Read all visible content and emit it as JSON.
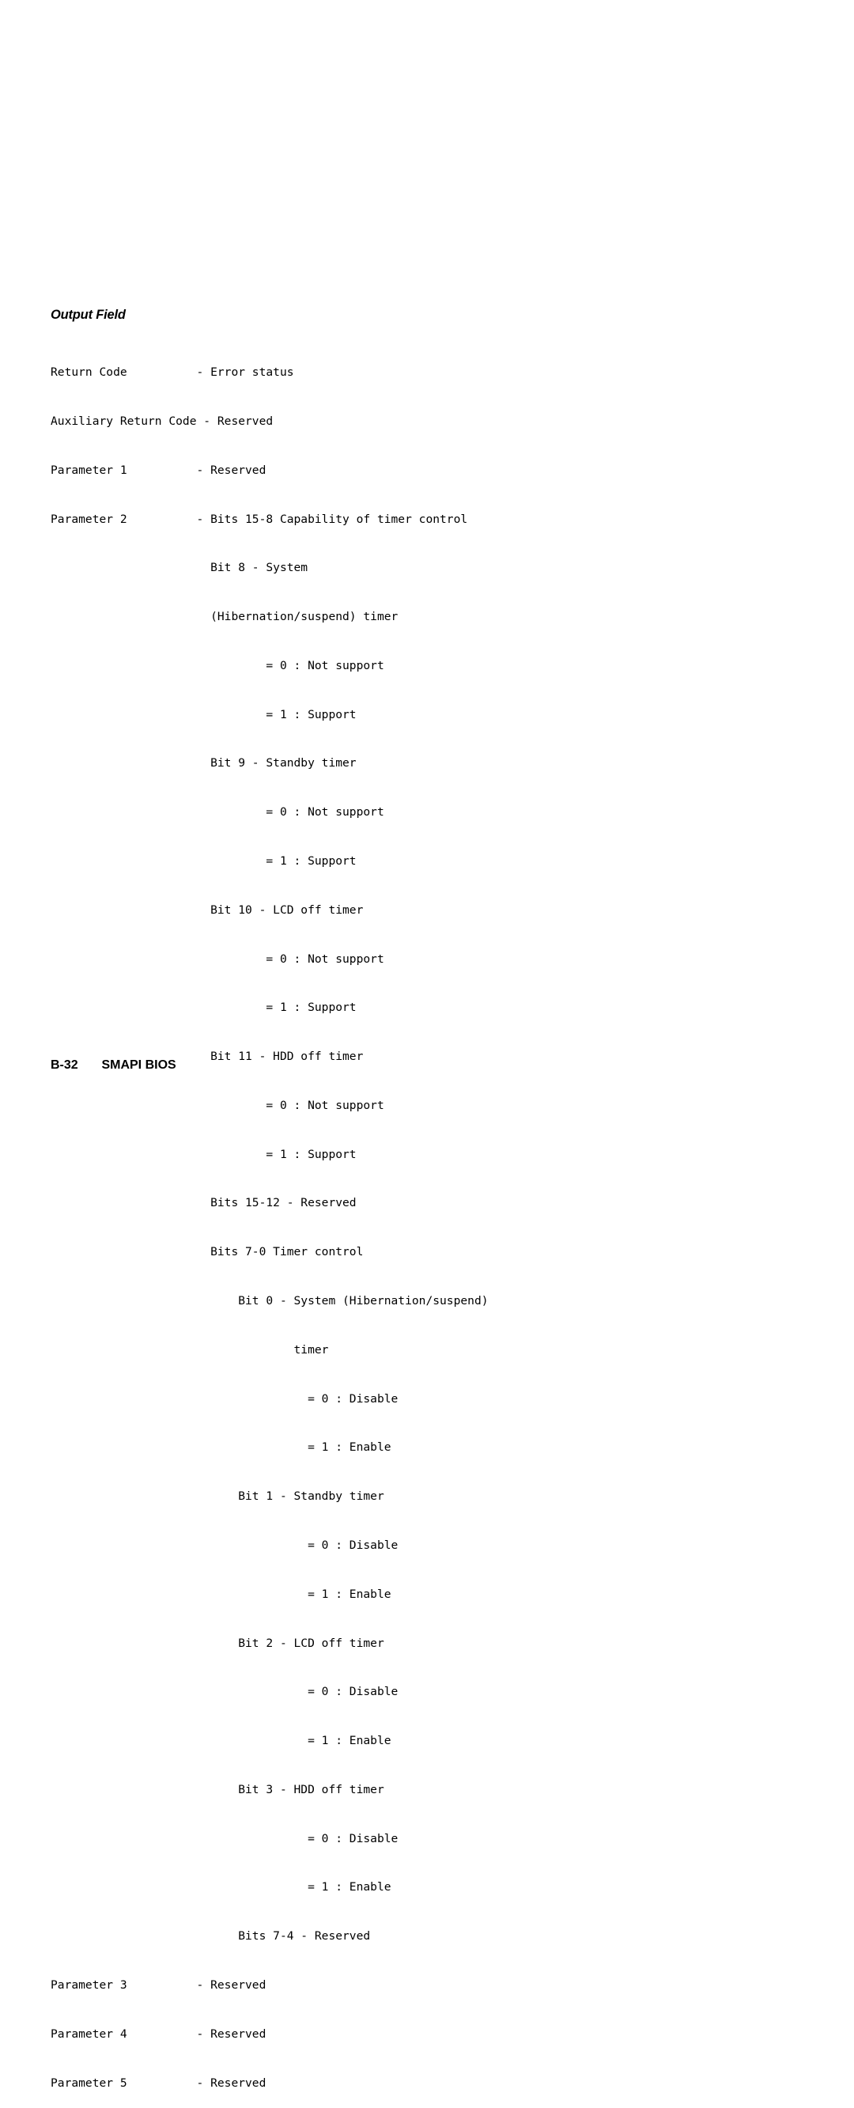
{
  "section": {
    "title": "Output Field"
  },
  "listing": {
    "lines": [
      "Return Code          - Error status",
      "Auxiliary Return Code - Reserved",
      "Parameter 1          - Reserved",
      "Parameter 2          - Bits 15-8 Capability of timer control",
      "                       Bit 8 - System",
      "                       (Hibernation/suspend) timer",
      "                               = 0 : Not support",
      "                               = 1 : Support",
      "                       Bit 9 - Standby timer",
      "                               = 0 : Not support",
      "                               = 1 : Support",
      "                       Bit 10 - LCD off timer",
      "                               = 0 : Not support",
      "                               = 1 : Support",
      "                       Bit 11 - HDD off timer",
      "                               = 0 : Not support",
      "                               = 1 : Support",
      "                       Bits 15-12 - Reserved",
      "                       Bits 7-0 Timer control",
      "                           Bit 0 - System (Hibernation/suspend)",
      "                                   timer",
      "                                     = 0 : Disable",
      "                                     = 1 : Enable",
      "                           Bit 1 - Standby timer",
      "                                     = 0 : Disable",
      "                                     = 1 : Enable",
      "                           Bit 2 - LCD off timer",
      "                                     = 0 : Disable",
      "                                     = 1 : Enable",
      "                           Bit 3 - HDD off timer",
      "                                     = 0 : Disable",
      "                                     = 1 : Enable",
      "                           Bits 7-4 - Reserved",
      "Parameter 3          - Reserved",
      "Parameter 4          - Reserved",
      "Parameter 5          - Reserved"
    ]
  },
  "footer": {
    "page_number": "B-32",
    "title": "SMAPI BIOS"
  }
}
